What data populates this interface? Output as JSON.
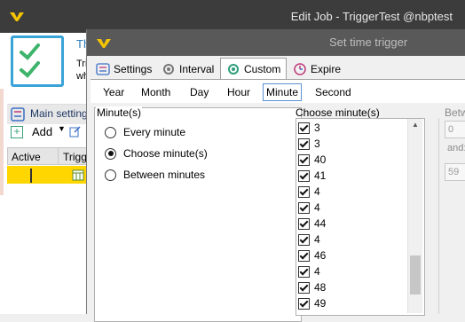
{
  "back_window": {
    "title": "Edit Job - TriggerTest @nbptest",
    "snippet_1": "Th",
    "snippet_2": "Tri",
    "snippet_3": "wh",
    "main_settings_label": "Main setting",
    "add_label": "Add",
    "grid_headers": [
      "Active",
      "Trigg"
    ]
  },
  "dialog": {
    "title": "Set time trigger",
    "tabs": [
      {
        "label": "Settings"
      },
      {
        "label": "Interval"
      },
      {
        "label": "Custom"
      },
      {
        "label": "Expire"
      }
    ],
    "active_tab": "Custom",
    "subtabs": [
      "Year",
      "Month",
      "Day",
      "Hour",
      "Minute",
      "Second"
    ],
    "active_subtab": "Minute",
    "minute_group_title": "Minute(s)",
    "radio_options": [
      {
        "label": "Every minute",
        "selected": false
      },
      {
        "label": "Choose minute(s)",
        "selected": true
      },
      {
        "label": "Between minutes",
        "selected": false
      }
    ],
    "choose_title": "Choose minute(s)",
    "minutes": [
      {
        "value": "3",
        "checked": true
      },
      {
        "value": "3",
        "checked": true
      },
      {
        "value": "40",
        "checked": true
      },
      {
        "value": "41",
        "checked": true
      },
      {
        "value": "4",
        "checked": true
      },
      {
        "value": "4",
        "checked": true
      },
      {
        "value": "44",
        "checked": true
      },
      {
        "value": "4",
        "checked": true
      },
      {
        "value": "46",
        "checked": true
      },
      {
        "value": "4",
        "checked": true
      },
      {
        "value": "48",
        "checked": true
      },
      {
        "value": "49",
        "checked": true
      }
    ],
    "between_title": "Betw",
    "between_from": "0",
    "between_and": "and:",
    "between_to": "59"
  },
  "colors": {
    "title_bar": "#3c3c3c",
    "dialog_title_bar": "#595959",
    "brand_yellow": "#f5c400",
    "selected_row": "#ffd600",
    "accent_blue": "#3aa3d8"
  }
}
